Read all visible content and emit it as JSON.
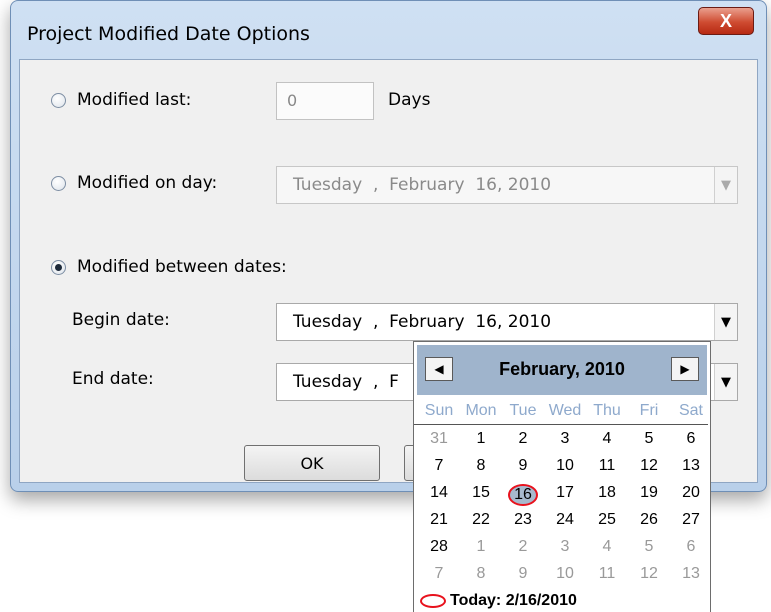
{
  "window": {
    "title": "Project Modified Date Options",
    "close_glyph": "X"
  },
  "options": {
    "modified_last": {
      "label": "Modified last:",
      "value": "0",
      "unit": "Days",
      "selected": false
    },
    "modified_on_day": {
      "label": "Modified on day:",
      "date": "Tuesday  ,  February  16, 2010",
      "selected": false
    },
    "modified_between": {
      "label": "Modified between dates:",
      "selected": true
    }
  },
  "begin": {
    "label": "Begin date:",
    "date": "Tuesday  ,  February  16, 2010"
  },
  "end": {
    "label": "End date:",
    "date": "Tuesday  ,  F"
  },
  "buttons": {
    "ok": "OK"
  },
  "calendar": {
    "month_title": "February, 2010",
    "prev_glyph": "◀",
    "next_glyph": "▶",
    "weekdays": [
      "Sun",
      "Mon",
      "Tue",
      "Wed",
      "Thu",
      "Fri",
      "Sat"
    ],
    "weeks": [
      [
        "31",
        "1",
        "2",
        "3",
        "4",
        "5",
        "6"
      ],
      [
        "7",
        "8",
        "9",
        "10",
        "11",
        "12",
        "13"
      ],
      [
        "14",
        "15",
        "16",
        "17",
        "18",
        "19",
        "20"
      ],
      [
        "21",
        "22",
        "23",
        "24",
        "25",
        "26",
        "27"
      ],
      [
        "28",
        "1",
        "2",
        "3",
        "4",
        "5",
        "6"
      ],
      [
        "7",
        "8",
        "9",
        "10",
        "11",
        "12",
        "13"
      ]
    ],
    "today_text": "Today: 2/16/2010",
    "highlight_color": "#e8121d"
  }
}
